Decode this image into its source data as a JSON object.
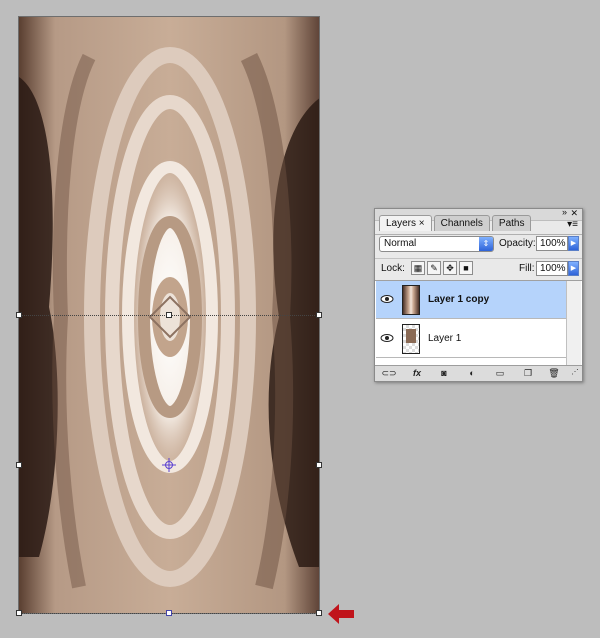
{
  "panel": {
    "tabs": [
      "Layers",
      "Channels",
      "Paths"
    ],
    "tab_close_glyph": "×",
    "blend_mode": "Normal",
    "opacity_label": "Opacity:",
    "opacity_value": "100%",
    "lock_label": "Lock:",
    "fill_label": "Fill:",
    "fill_value": "100%",
    "layers": [
      {
        "name": "Layer 1 copy",
        "selected": true,
        "visible": true
      },
      {
        "name": "Layer 1",
        "selected": false,
        "visible": true
      }
    ],
    "footer_icons": [
      "link-icon",
      "fx-icon",
      "mask-icon",
      "adjustment-icon",
      "group-folder-icon",
      "new-layer-icon",
      "trash-icon"
    ],
    "fx_label": "fx"
  },
  "colors": {
    "selection": "#b5d3fb",
    "arrow": "#c0141b",
    "image_tone": "#b89a82"
  }
}
